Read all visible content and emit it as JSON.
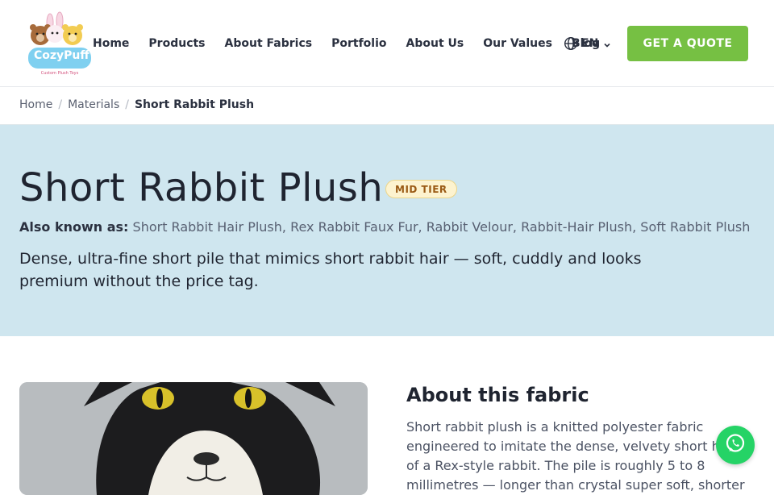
{
  "brand": {
    "logo_text": "CozyPuff",
    "logo_subtext": "Custom Plush Toys"
  },
  "nav": {
    "items": [
      {
        "label": "Home"
      },
      {
        "label": "Products"
      },
      {
        "label": "About Fabrics"
      },
      {
        "label": "Portfolio"
      },
      {
        "label": "About Us"
      },
      {
        "label": "Our Values"
      },
      {
        "label": "Blog"
      }
    ],
    "language": "EN",
    "cta_label": "GET A QUOTE"
  },
  "breadcrumb": {
    "items": [
      {
        "label": "Home"
      },
      {
        "label": "Materials"
      }
    ],
    "separator": "/",
    "current": "Short Rabbit Plush"
  },
  "hero": {
    "title": "Short Rabbit Plush",
    "badge": "MID TIER",
    "aka_label": "Also known as:",
    "aka_values": "Short Rabbit Hair Plush, Rex Rabbit Faux Fur, Rabbit Velour, Rabbit-Hair Plush, Soft Rabbit Plush",
    "tagline": "Dense, ultra-fine short pile that mimics short rabbit hair — soft, cuddly and looks premium without the price tag."
  },
  "about": {
    "title": "About this fabric",
    "text": "Short rabbit plush is a knitted polyester fabric engineered to imitate the dense, velvety short hair of a Rex-style rabbit. The pile is roughly 5 to 8 millimetres — longer than crystal super soft, shorter"
  },
  "colors": {
    "accent_green": "#76c043",
    "hero_bg": "#cfe6ef",
    "badge_bg": "#fdf3cf",
    "badge_text": "#9a5a14",
    "whatsapp": "#25d366"
  },
  "icons": {
    "language": "globe-icon",
    "language_caret": "chevron-down-icon",
    "chat": "whatsapp-icon"
  }
}
